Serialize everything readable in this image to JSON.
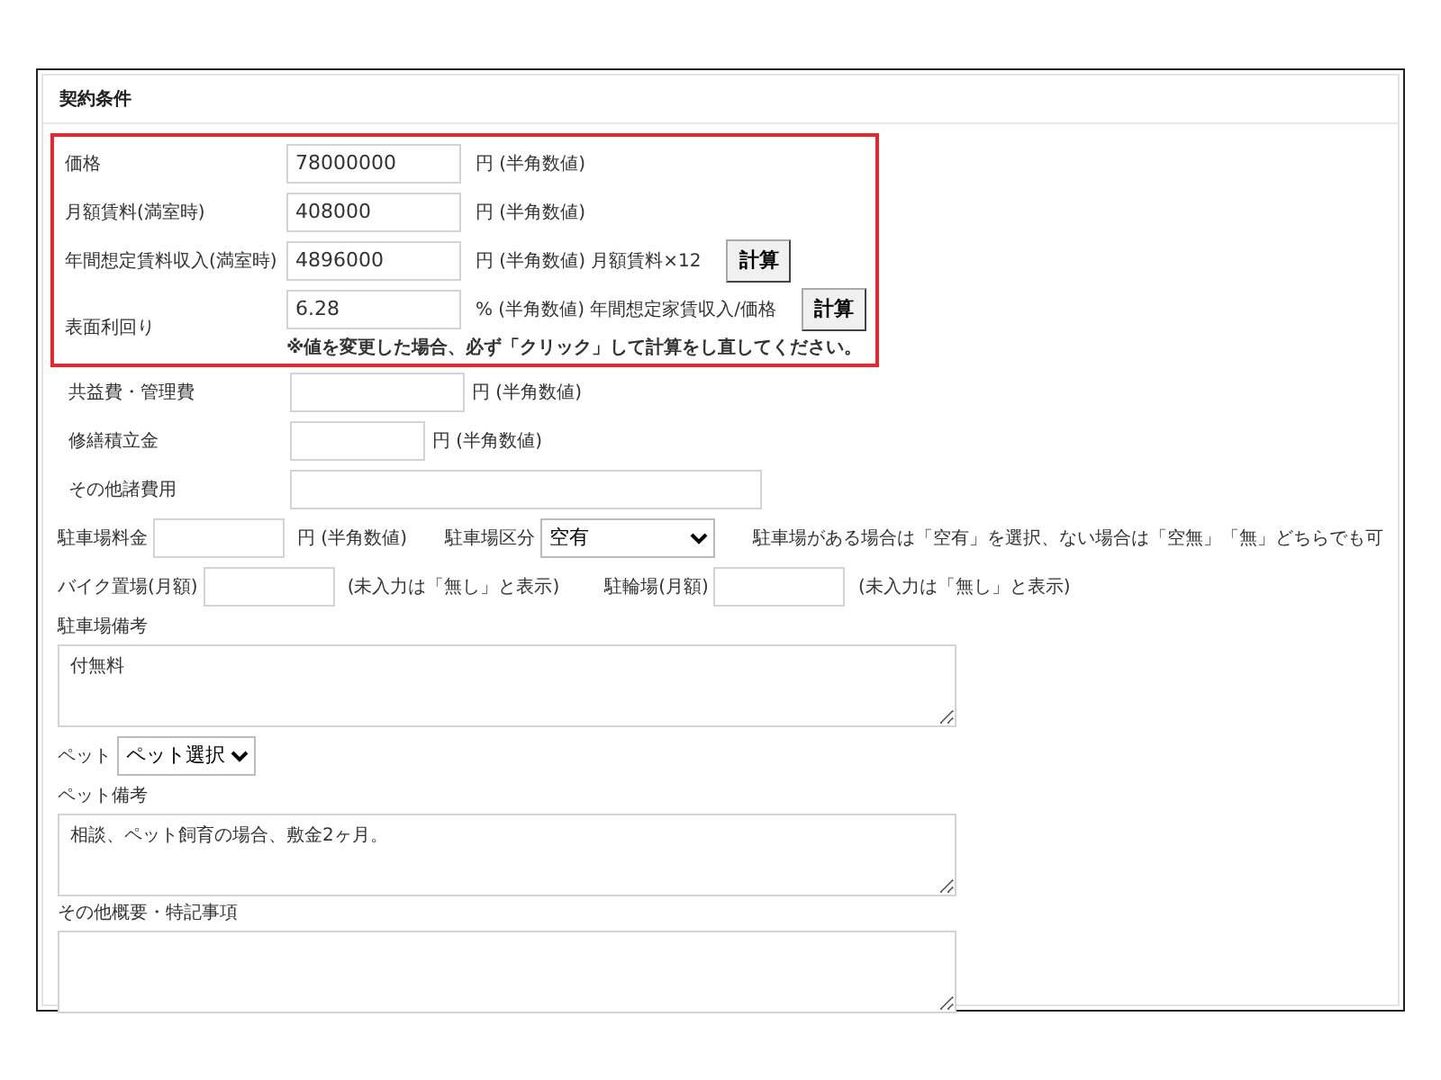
{
  "section_title": "契約条件",
  "calc_fields": [
    {
      "label": "価格",
      "value": "78000000",
      "hint": "円 (半角数値)"
    },
    {
      "label": "月額賃料(満室時)",
      "value": "408000",
      "hint": "円 (半角数値)"
    },
    {
      "label": "年間想定賃料収入(満室時)",
      "value": "4896000",
      "hint": "円 (半角数値) 月額賃料×12",
      "button": "計算"
    },
    {
      "label": "表面利回り",
      "value": "6.28",
      "hint": "% (半角数値) 年間想定家賃収入/価格",
      "button": "計算"
    }
  ],
  "calc_note": "※値を変更した場合、必ず「クリック」して計算をし直してください。",
  "cost_fields": [
    {
      "label": "共益費・管理費",
      "hint": "円 (半角数値)"
    },
    {
      "label": "修繕積立金",
      "hint": "円 (半角数値)"
    },
    {
      "label": "その他諸費用"
    }
  ],
  "parking": {
    "fee_label": "駐車場料金",
    "fee_hint": "円 (半角数値)",
    "type_label": "駐車場区分",
    "type_value": "空有",
    "type_note": "駐車場がある場合は「空有」を選択、ない場合は「空無」「無」どちらでも可"
  },
  "bike": {
    "label": "バイク置場(月額)",
    "hint": "(未入力は「無し」と表示)"
  },
  "bicycle": {
    "label": "駐輪場(月額)",
    "hint": "(未入力は「無し」と表示)"
  },
  "parking_remarks": {
    "label": "駐車場備考",
    "value": "付無料"
  },
  "pet": {
    "label": "ペット",
    "value": "ペット選択"
  },
  "pet_remarks": {
    "label": "ペット備考",
    "value": "相談、ペット飼育の場合、敷金2ヶ月。"
  },
  "other_remarks": {
    "label": "その他概要・特記事項"
  }
}
